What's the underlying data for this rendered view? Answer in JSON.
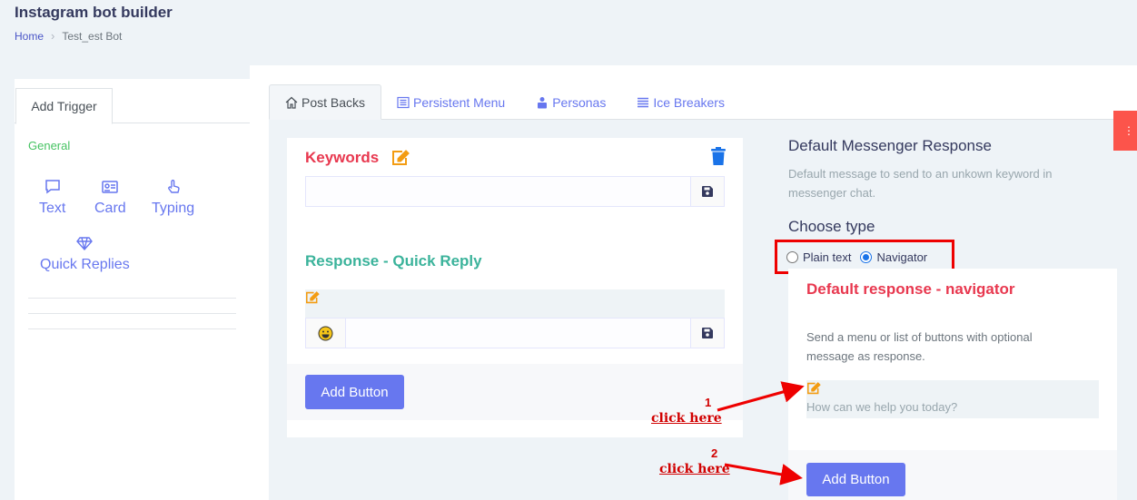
{
  "app": {
    "title": "Instagram bot builder",
    "breadcrumb": {
      "home": "Home",
      "current": "Test_est Bot"
    }
  },
  "left_panel": {
    "tab_label": "Add Trigger",
    "section_label": "General",
    "tools": [
      {
        "label": "Text",
        "icon": "chat-bubble-icon"
      },
      {
        "label": "Card",
        "icon": "id-card-icon"
      },
      {
        "label": "Typing",
        "icon": "pointer-hand-icon"
      },
      {
        "label": "Quick Replies",
        "icon": "diamond-icon"
      }
    ]
  },
  "tabs": [
    {
      "label": "Post Backs",
      "icon": "home-icon",
      "active": true
    },
    {
      "label": "Persistent Menu",
      "icon": "list-icon",
      "active": false
    },
    {
      "label": "Personas",
      "icon": "user-icon",
      "active": false
    },
    {
      "label": "Ice Breakers",
      "icon": "lines-icon",
      "active": false
    }
  ],
  "keywords_card": {
    "title": "Keywords",
    "keyword_value": "",
    "quick_reply_title": "Response - Quick Reply",
    "quick_reply_value": "",
    "add_button": "Add Button"
  },
  "default_response": {
    "title": "Default Messenger Response",
    "description": "Default message to send to an unkown keyword in messenger chat.",
    "choose_type": "Choose type",
    "options": [
      {
        "label": "Plain text",
        "selected": false
      },
      {
        "label": "Navigator",
        "selected": true
      }
    ],
    "navigator_title": "Default response - navigator",
    "navigator_desc": "Send a menu or list of buttons with optional message as response.",
    "message_placeholder": "How can we help you today?",
    "add_button": "Add Button"
  },
  "annotations": [
    {
      "number": "1",
      "text": "click here"
    },
    {
      "number": "2",
      "text": "click here"
    }
  ],
  "colors": {
    "primary": "#6777ef",
    "danger": "#e8384f",
    "success_title": "#3bb39b",
    "edit_icon": "#f39c12",
    "annotation": "#d10000"
  }
}
